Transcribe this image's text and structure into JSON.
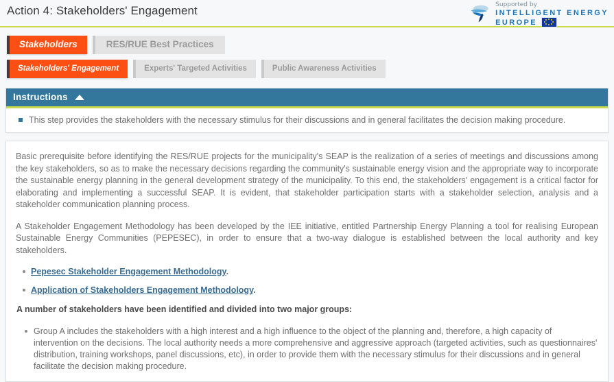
{
  "header": {
    "title": "Action 4: Stakeholders' Engagement",
    "logo": {
      "supported_by": "Supported by",
      "line1": "INTELLIGENT ENERGY",
      "line2": "EUROPE",
      "mark_icon": "leaf-swoosh-icon",
      "flag_icon": "eu-flag-icon"
    },
    "accent_color": "#cada4a"
  },
  "tabs_primary": [
    {
      "label": "Stakeholders",
      "active": true
    },
    {
      "label": "RES/RUE Best Practices",
      "active": false
    }
  ],
  "tabs_secondary": [
    {
      "label": "Stakeholders' Engagement",
      "active": true
    },
    {
      "label": "Experts' Targeted Activities",
      "active": false
    },
    {
      "label": "Public Awareness Activities",
      "active": false
    }
  ],
  "instructions": {
    "title": "Instructions",
    "collapse_icon": "caret-up-icon",
    "header_color": "#33779c",
    "items": [
      "This step provides the stakeholders with the necessary stimulus for their discussions and in general facilitates the decision making procedure."
    ]
  },
  "content": {
    "paragraphs": [
      "Basic prerequisite before identifying the RES/RUE projects for the municipality's SEAP is the realization of a series of meetings and discussions among the key stakeholders, so as to make the necessary decisions regarding the community's sustainable energy vision and the appropriate way to incorporate the sustainable energy planning in the general development strategy of the municipality. To this end, the stakeholders' engagement is a critical factor for elaborating and implementing a successful SEAP. It is evident, that stakeholder participation starts with a stakeholder selection, analysis and a stakeholder communication planning process.",
      "A Stakeholder Engagement Methodology has been developed by the IEE initiative, entitled Partnership Energy Planning a tool for realising European Sustainable Energy Communities (PEPESEC), in order to ensure that a two-way dialogue is established between the local authority and key stakeholders."
    ],
    "links": [
      {
        "label": "Pepesec Stakeholder Engagement Methodology",
        "trailing": "."
      },
      {
        "label": "Application of Stakeholders Engagement Methodology",
        "trailing": "."
      }
    ],
    "groups_heading": "A number of stakeholders have been identified and divided into two major groups:",
    "groups": [
      "Group A includes the stakeholders with a high interest and a high influence to the object of the planning and, therefore, a high capacity of intervention on the decisions. The local authority needs a more comprehensive and aggressive approach (targeted activities, such as questionnaires' distribution, training workshops, panel discussions, etc), in order to provide them with the necessary stimulus for their discussions and in general facilitate the decision making procedure."
    ]
  }
}
